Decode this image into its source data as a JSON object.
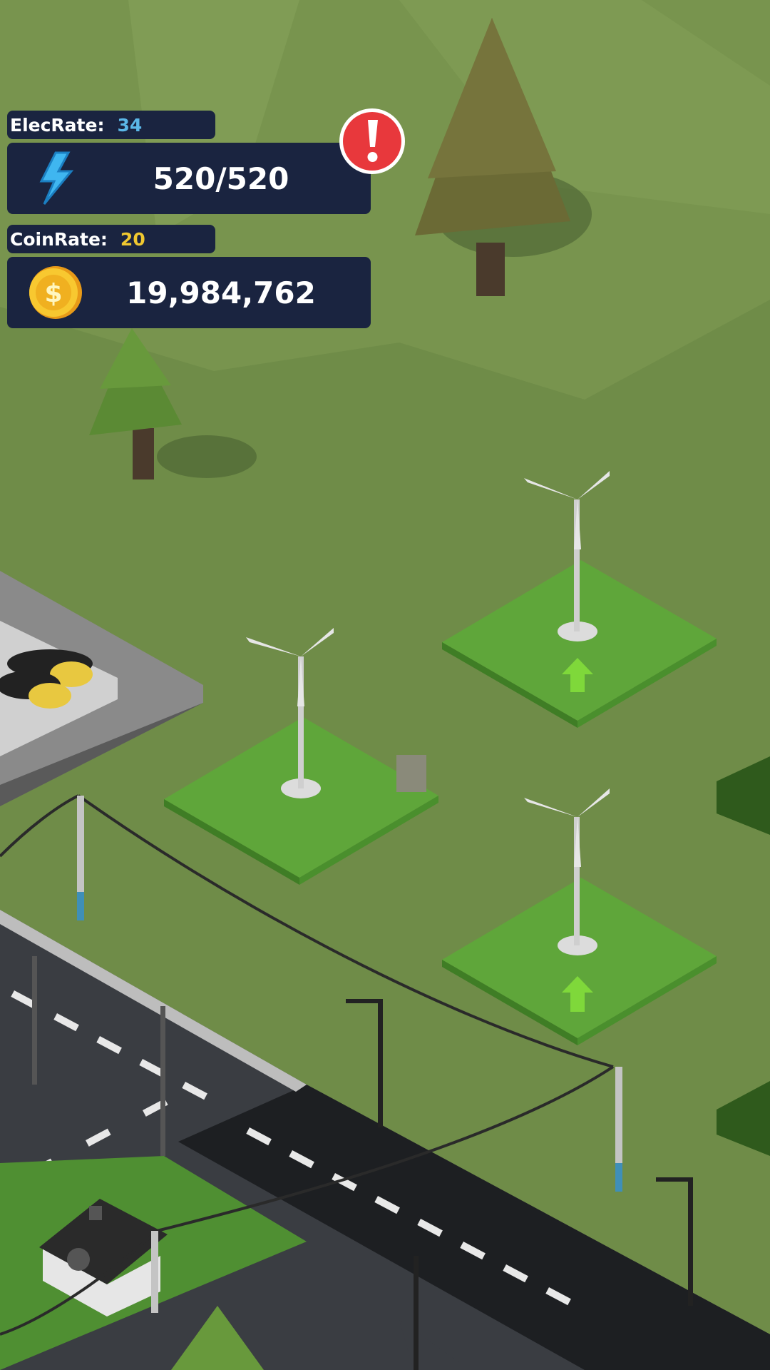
{
  "hud": {
    "elec_rate_label": "ElecRate:",
    "elec_rate_value": "34",
    "energy_value": "520/520",
    "coin_rate_label": "CoinRate:",
    "coin_rate_value": "20",
    "coins_value": "19,984,762"
  },
  "icons": {
    "energy": "lightning-bolt-icon",
    "coin": "dollar-coin-icon",
    "alert": "exclamation-alert-icon",
    "upgrade": "upgrade-arrow-icon"
  },
  "colors": {
    "panel_bg": "#1a2440",
    "elec_rate_value": "#5bb8e8",
    "coin_rate_value": "#f0c830",
    "ground": "#6f8c48",
    "tile": "#5fa63a",
    "alert_red": "#e8383c",
    "upgrade_arrow": "#7fd83a"
  }
}
